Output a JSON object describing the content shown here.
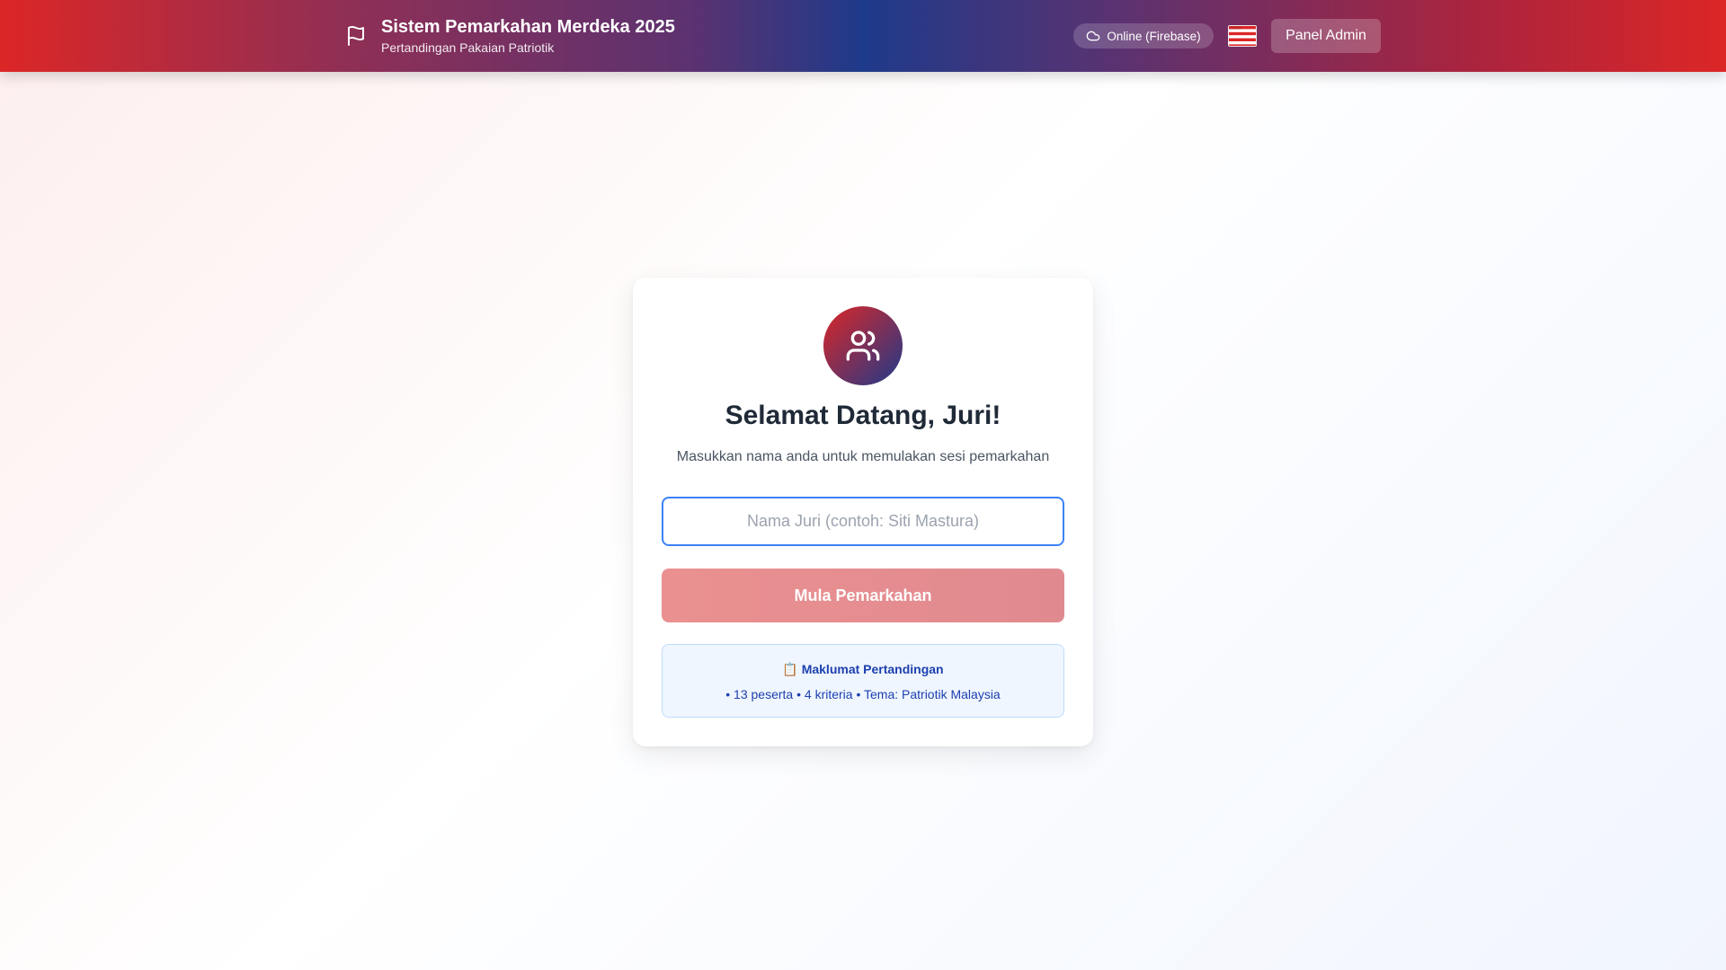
{
  "header": {
    "title": "Sistem Pemarkahan Merdeka 2025",
    "subtitle": "Pertandingan Pakaian Patriotik",
    "status": "Online (Firebase)",
    "admin_button": "Panel Admin",
    "flag_icon": "flag-icon",
    "status_icon": "cloud-icon",
    "country_flag": "malaysia-flag-icon"
  },
  "login_card": {
    "avatar_icon": "users-icon",
    "title": "Selamat Datang, Juri!",
    "subtitle": "Masukkan nama anda untuk memulakan sesi pemarkahan",
    "name_input": {
      "value": "",
      "placeholder": "Nama Juri (contoh: Siti Mastura)"
    },
    "start_button": "Mula Pemarkahan",
    "info": {
      "title": "📋 Maklumat Pertandingan",
      "text": "• 13 peserta • 4 kriteria • Tema: Patriotik Malaysia"
    }
  },
  "colors": {
    "red": "#dc2626",
    "blue": "#1e3a8a",
    "input_border": "#3b82f6",
    "info_text": "#1e40af"
  }
}
